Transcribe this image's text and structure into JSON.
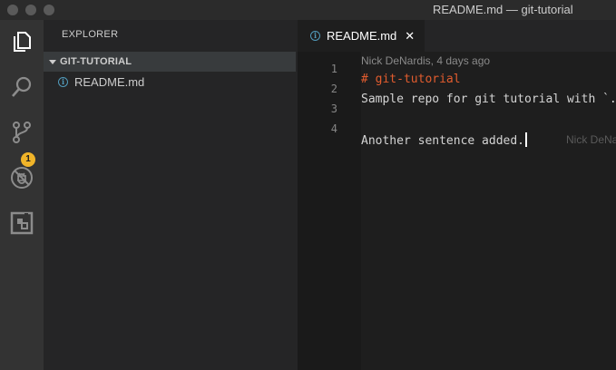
{
  "window": {
    "title": "README.md — git-tutorial"
  },
  "activity_bar": {
    "items": [
      {
        "name": "files-icon"
      },
      {
        "name": "search-icon"
      },
      {
        "name": "source-control-icon",
        "badge": "1"
      },
      {
        "name": "debug-icon"
      },
      {
        "name": "extensions-icon"
      }
    ]
  },
  "sidebar": {
    "header": "EXPLORER",
    "folder": "GIT-TUTORIAL",
    "files": [
      {
        "name": "README.md"
      }
    ]
  },
  "editor": {
    "tab": {
      "label": "README.md",
      "close": "✕"
    },
    "blame_header": "Nick DeNardis, 4 days ago",
    "line_numbers": [
      "1",
      "2",
      "3",
      "4"
    ],
    "lines": [
      "# git-tutorial",
      "Sample repo for git tutorial with `.",
      "",
      "Another sentence added."
    ],
    "inline_blame": "Nick DeNardis"
  },
  "colors": {
    "accent_badge": "#f0b429",
    "heading": "#e25c2e",
    "info": "#519aba"
  }
}
